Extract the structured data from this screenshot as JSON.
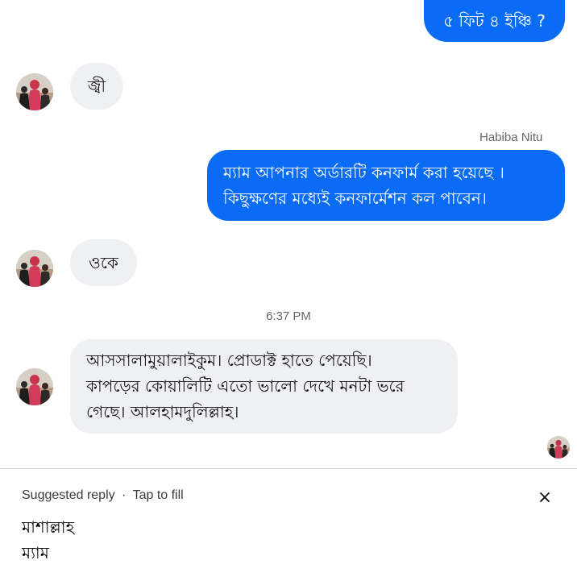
{
  "messages": [
    {
      "type": "sent",
      "text": "৫ ফিট ৪ ইঞ্চি ?"
    },
    {
      "type": "received",
      "text": "জ্বী"
    },
    {
      "type": "sender_label",
      "text": "Habiba Nitu"
    },
    {
      "type": "sent",
      "lines": [
        "ম্যাম আপনার অর্ডারটি কনফার্ম করা হয়েছে ।",
        "কিছুক্ষণের মধ্যেই কনফার্মেশন কল পাবেন।"
      ]
    },
    {
      "type": "received",
      "text": "ওকে"
    },
    {
      "type": "timestamp",
      "text": "6:37 PM"
    },
    {
      "type": "received",
      "lines": [
        "আসসালামুয়ালাইকুম। প্রোডাক্ট হাতে পেয়েছি।",
        "কাপড়ের কোয়ালিটি এতো ভালো দেখে মনটা ভরে",
        "গেছে। আলহামদুলিল্লাহ।"
      ]
    }
  ],
  "suggested_reply": {
    "label": "Suggested reply",
    "separator": "·",
    "action": "Tap to fill",
    "close_icon": "×",
    "lines": [
      "মাশাল্লাহ",
      "ম্যাম"
    ]
  },
  "colors": {
    "sent_bubble": "#0a6cf5",
    "received_bubble": "#eff0f3",
    "meta_text": "#65676b"
  }
}
